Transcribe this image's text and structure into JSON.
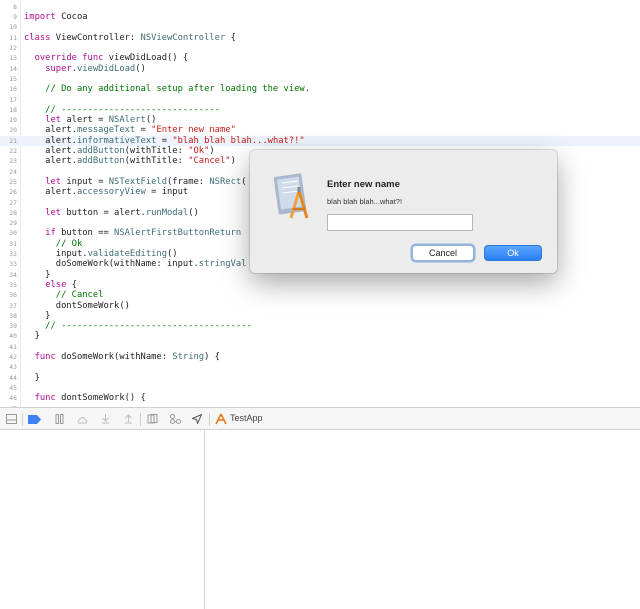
{
  "editor": {
    "lines": [
      {
        "n": "8",
        "parts": []
      },
      {
        "n": "9",
        "parts": [
          {
            "c": "k",
            "t": "import"
          },
          {
            "c": "p",
            "t": " Cocoa"
          }
        ]
      },
      {
        "n": "10",
        "parts": []
      },
      {
        "n": "11",
        "parts": [
          {
            "c": "k",
            "t": "class"
          },
          {
            "c": "p",
            "t": " ViewController: "
          },
          {
            "c": "t",
            "t": "NSViewController"
          },
          {
            "c": "p",
            "t": " {"
          }
        ]
      },
      {
        "n": "12",
        "parts": []
      },
      {
        "n": "13",
        "parts": [
          {
            "c": "p",
            "t": "  "
          },
          {
            "c": "k",
            "t": "override func"
          },
          {
            "c": "p",
            "t": " viewDidLoad() {"
          }
        ]
      },
      {
        "n": "14",
        "parts": [
          {
            "c": "p",
            "t": "    "
          },
          {
            "c": "k",
            "t": "super"
          },
          {
            "c": "p",
            "t": "."
          },
          {
            "c": "t",
            "t": "viewDidLoad"
          },
          {
            "c": "p",
            "t": "()"
          }
        ]
      },
      {
        "n": "15",
        "parts": []
      },
      {
        "n": "16",
        "parts": [
          {
            "c": "cm",
            "t": "    // Do any additional setup after loading the view."
          }
        ]
      },
      {
        "n": "17",
        "parts": []
      },
      {
        "n": "18",
        "parts": [
          {
            "c": "cm",
            "t": "    // ------------------------------"
          }
        ]
      },
      {
        "n": "19",
        "parts": [
          {
            "c": "p",
            "t": "    "
          },
          {
            "c": "k",
            "t": "let"
          },
          {
            "c": "p",
            "t": " alert = "
          },
          {
            "c": "t",
            "t": "NSAlert"
          },
          {
            "c": "p",
            "t": "()"
          }
        ]
      },
      {
        "n": "20",
        "parts": [
          {
            "c": "p",
            "t": "    alert."
          },
          {
            "c": "t",
            "t": "messageText"
          },
          {
            "c": "p",
            "t": " = "
          },
          {
            "c": "s",
            "t": "\"Enter new name\""
          }
        ]
      },
      {
        "n": "21",
        "hl": true,
        "parts": [
          {
            "c": "p",
            "t": "    alert."
          },
          {
            "c": "t",
            "t": "informativeText"
          },
          {
            "c": "p",
            "t": " = "
          },
          {
            "c": "s",
            "t": "\"blah blah blah...what?!\""
          }
        ]
      },
      {
        "n": "22",
        "parts": [
          {
            "c": "p",
            "t": "    alert."
          },
          {
            "c": "t",
            "t": "addButton"
          },
          {
            "c": "p",
            "t": "(withTitle: "
          },
          {
            "c": "s",
            "t": "\"Ok\""
          },
          {
            "c": "p",
            "t": ")"
          }
        ]
      },
      {
        "n": "23",
        "parts": [
          {
            "c": "p",
            "t": "    alert."
          },
          {
            "c": "t",
            "t": "addButton"
          },
          {
            "c": "p",
            "t": "(withTitle: "
          },
          {
            "c": "s",
            "t": "\"Cancel\""
          },
          {
            "c": "p",
            "t": ")"
          }
        ]
      },
      {
        "n": "24",
        "parts": []
      },
      {
        "n": "25",
        "parts": [
          {
            "c": "p",
            "t": "    "
          },
          {
            "c": "k",
            "t": "let"
          },
          {
            "c": "p",
            "t": " input = "
          },
          {
            "c": "t",
            "t": "NSTextField"
          },
          {
            "c": "p",
            "t": "(frame: "
          },
          {
            "c": "t",
            "t": "NSRect"
          },
          {
            "c": "p",
            "t": "("
          }
        ]
      },
      {
        "n": "26",
        "parts": [
          {
            "c": "p",
            "t": "    alert."
          },
          {
            "c": "t",
            "t": "accessoryView"
          },
          {
            "c": "p",
            "t": " = input"
          }
        ]
      },
      {
        "n": "27",
        "parts": []
      },
      {
        "n": "28",
        "parts": [
          {
            "c": "p",
            "t": "    "
          },
          {
            "c": "k",
            "t": "let"
          },
          {
            "c": "p",
            "t": " button = alert."
          },
          {
            "c": "t",
            "t": "runModal"
          },
          {
            "c": "p",
            "t": "()"
          }
        ]
      },
      {
        "n": "29",
        "parts": []
      },
      {
        "n": "30",
        "parts": [
          {
            "c": "p",
            "t": "    "
          },
          {
            "c": "k",
            "t": "if"
          },
          {
            "c": "p",
            "t": " button == "
          },
          {
            "c": "t",
            "t": "NSAlertFirstButtonReturn"
          }
        ]
      },
      {
        "n": "31",
        "parts": [
          {
            "c": "cm",
            "t": "      // Ok"
          }
        ]
      },
      {
        "n": "32",
        "parts": [
          {
            "c": "p",
            "t": "      input."
          },
          {
            "c": "t",
            "t": "validateEditing"
          },
          {
            "c": "p",
            "t": "()"
          }
        ]
      },
      {
        "n": "33",
        "parts": [
          {
            "c": "p",
            "t": "      doSomeWork(withName: input."
          },
          {
            "c": "t",
            "t": "stringVal"
          }
        ]
      },
      {
        "n": "34",
        "parts": [
          {
            "c": "p",
            "t": "    }"
          }
        ]
      },
      {
        "n": "35",
        "parts": [
          {
            "c": "p",
            "t": "    "
          },
          {
            "c": "k",
            "t": "else"
          },
          {
            "c": "p",
            "t": " {"
          }
        ]
      },
      {
        "n": "36",
        "parts": [
          {
            "c": "cm",
            "t": "      // Cancel"
          }
        ]
      },
      {
        "n": "37",
        "parts": [
          {
            "c": "p",
            "t": "      dontSomeWork()"
          }
        ]
      },
      {
        "n": "38",
        "parts": [
          {
            "c": "p",
            "t": "    }"
          }
        ]
      },
      {
        "n": "39",
        "parts": [
          {
            "c": "cm",
            "t": "    // ------------------------------------"
          }
        ]
      },
      {
        "n": "40",
        "parts": [
          {
            "c": "p",
            "t": "  }"
          }
        ]
      },
      {
        "n": "41",
        "parts": []
      },
      {
        "n": "42",
        "parts": [
          {
            "c": "p",
            "t": "  "
          },
          {
            "c": "k",
            "t": "func"
          },
          {
            "c": "p",
            "t": " doSomeWork(withName: "
          },
          {
            "c": "t",
            "t": "String"
          },
          {
            "c": "p",
            "t": ") {"
          }
        ]
      },
      {
        "n": "43",
        "parts": []
      },
      {
        "n": "44",
        "parts": [
          {
            "c": "p",
            "t": "  }"
          }
        ]
      },
      {
        "n": "45",
        "parts": []
      },
      {
        "n": "46",
        "parts": [
          {
            "c": "p",
            "t": "  "
          },
          {
            "c": "k",
            "t": "func"
          },
          {
            "c": "p",
            "t": " dontSomeWork() {"
          }
        ]
      },
      {
        "n": "47",
        "parts": []
      }
    ]
  },
  "debugbar": {
    "target_label": "TestApp",
    "icons": [
      "hide-debug-area-icon",
      "breakpoints-toggle-icon",
      "pause-icon",
      "step-over-icon",
      "step-into-icon",
      "step-out-icon",
      "view-hierarchy-icon",
      "memory-graph-icon",
      "simulate-location-icon",
      "app-target-icon"
    ]
  },
  "alert": {
    "title": "Enter new name",
    "informative_text": "blah blah blah...what?!",
    "input_value": "",
    "input_placeholder": "",
    "cancel_label": "Cancel",
    "ok_label": "Ok",
    "icon": "xcode-app-icon"
  },
  "colors": {
    "keyword": "#aa0d91",
    "type": "#3f6e74",
    "string": "#c41a16",
    "comment": "#007400",
    "accent": "#2b7ff2"
  }
}
